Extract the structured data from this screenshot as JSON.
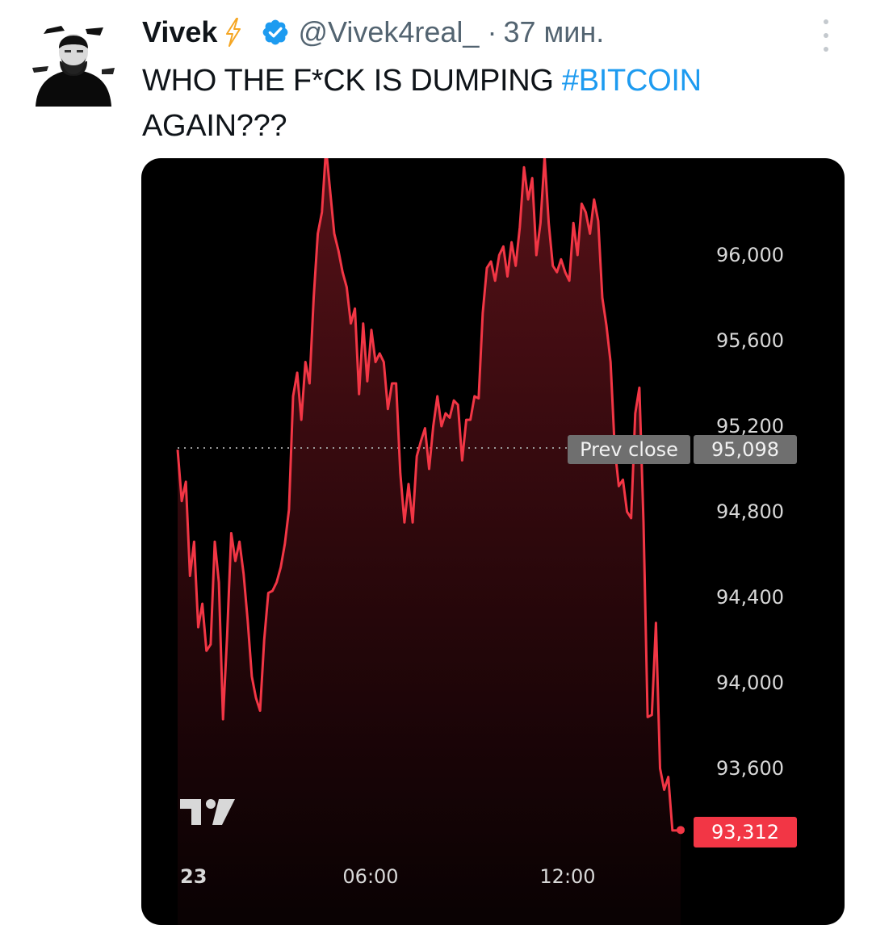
{
  "tweet": {
    "author_name": "Vivek",
    "handle": "@Vivek4real_",
    "time": "37 мин.",
    "separator": "·",
    "text_prefix": "WHO THE F*CK IS DUMPING ",
    "hashtag": "#BITCOIN",
    "text_suffix": "AGAIN???",
    "icons": [
      "avatar",
      "lightning-bolt-icon",
      "verified-badge-icon",
      "more-options-icon"
    ],
    "colors": {
      "hashtag": "#1d9bf0",
      "handle": "#536471",
      "verified": "#1d9bf0",
      "bolt": "#f5a623"
    }
  },
  "chart_data": {
    "type": "area",
    "price_axis": {
      "ticks": [
        "96,000",
        "95,600",
        "95,200",
        "94,800",
        "94,400",
        "94,000",
        "93,600"
      ],
      "values": [
        96000,
        95600,
        95200,
        94800,
        94400,
        94000,
        93600
      ]
    },
    "time_axis": {
      "ticks": [
        "23",
        "06:00",
        "12:00"
      ]
    },
    "prev_close": {
      "label": "Prev close",
      "value": "95,098"
    },
    "last_price": {
      "value": "93,312"
    },
    "logo": "tradingview-logo",
    "colors": {
      "line": "#f23645",
      "background": "#000000",
      "last_badge": "#f23645",
      "prev_close_badge": "#6f6f6f"
    },
    "series": [
      {
        "values": [
          95090,
          94850,
          94940,
          94500,
          94660,
          94260,
          94370,
          94150,
          94180,
          94660,
          94470,
          93830,
          94220,
          94700,
          94570,
          94660,
          94510,
          94290,
          94030,
          93930,
          93870,
          94200,
          94420,
          94430,
          94470,
          94540,
          94650,
          94810,
          95340,
          95450,
          95230,
          95500,
          95400,
          95800,
          96100,
          96200,
          96500,
          96300,
          96100,
          96020,
          95920,
          95850,
          95680,
          95750,
          95350,
          95680,
          95410,
          95650,
          95500,
          95540,
          95500,
          95280,
          95400,
          95400,
          94980,
          94750,
          94930,
          94750,
          95060,
          95130,
          95190,
          95000,
          95200,
          95340,
          95200,
          95260,
          95240,
          95320,
          95300,
          95040,
          95230,
          95230,
          95340,
          95330,
          95730,
          95940,
          95970,
          95880,
          96000,
          96040,
          95900,
          96060,
          95950,
          96130,
          96410,
          96260,
          96360,
          96000,
          96150,
          96460,
          96150,
          95950,
          95920,
          95980,
          95920,
          95880,
          96150,
          96000,
          96240,
          96200,
          96100,
          96260,
          96160,
          95800,
          95670,
          95500,
          95100,
          94920,
          94950,
          94800,
          94770,
          95260,
          95380,
          94750,
          93840,
          93850,
          94280,
          93600,
          93500,
          93560,
          93310,
          93310,
          93312
        ]
      }
    ]
  }
}
